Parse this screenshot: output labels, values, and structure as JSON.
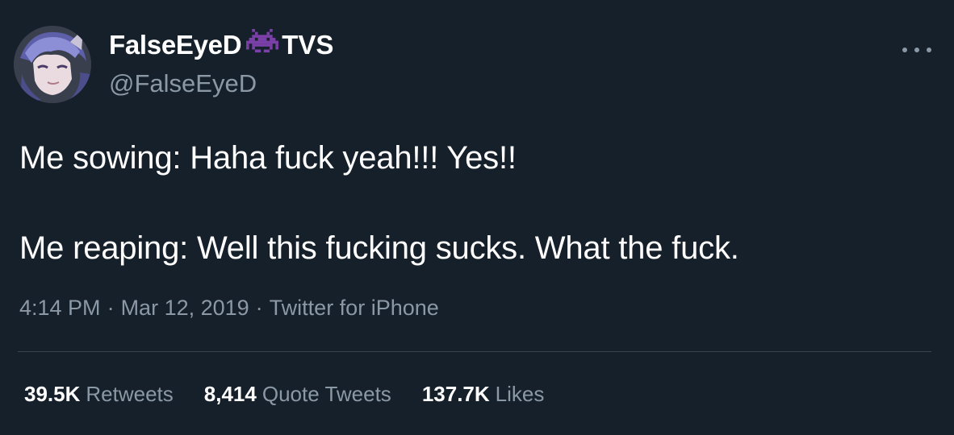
{
  "user": {
    "display_name": "FalseEyeD",
    "name_emoji": "alien-monster-emoji",
    "name_suffix": "TVS",
    "handle": "@FalseEyeD"
  },
  "tweet": {
    "line1": "Me sowing: Haha fuck yeah!!! Yes!!",
    "line2": "Me reaping: Well this fucking sucks. What the fuck."
  },
  "meta": {
    "time": "4:14 PM",
    "separator": "·",
    "date": "Mar 12, 2019",
    "source": "Twitter for iPhone"
  },
  "stats": {
    "retweets_count": "39.5K",
    "retweets_label": "Retweets",
    "quotes_count": "8,414",
    "quotes_label": "Quote Tweets",
    "likes_count": "137.7K",
    "likes_label": "Likes"
  },
  "colors": {
    "background": "#15202b",
    "text_primary": "#ffffff",
    "text_secondary": "#8b98a5",
    "divider": "#38444d",
    "emoji_purple": "#7b3fa8"
  }
}
